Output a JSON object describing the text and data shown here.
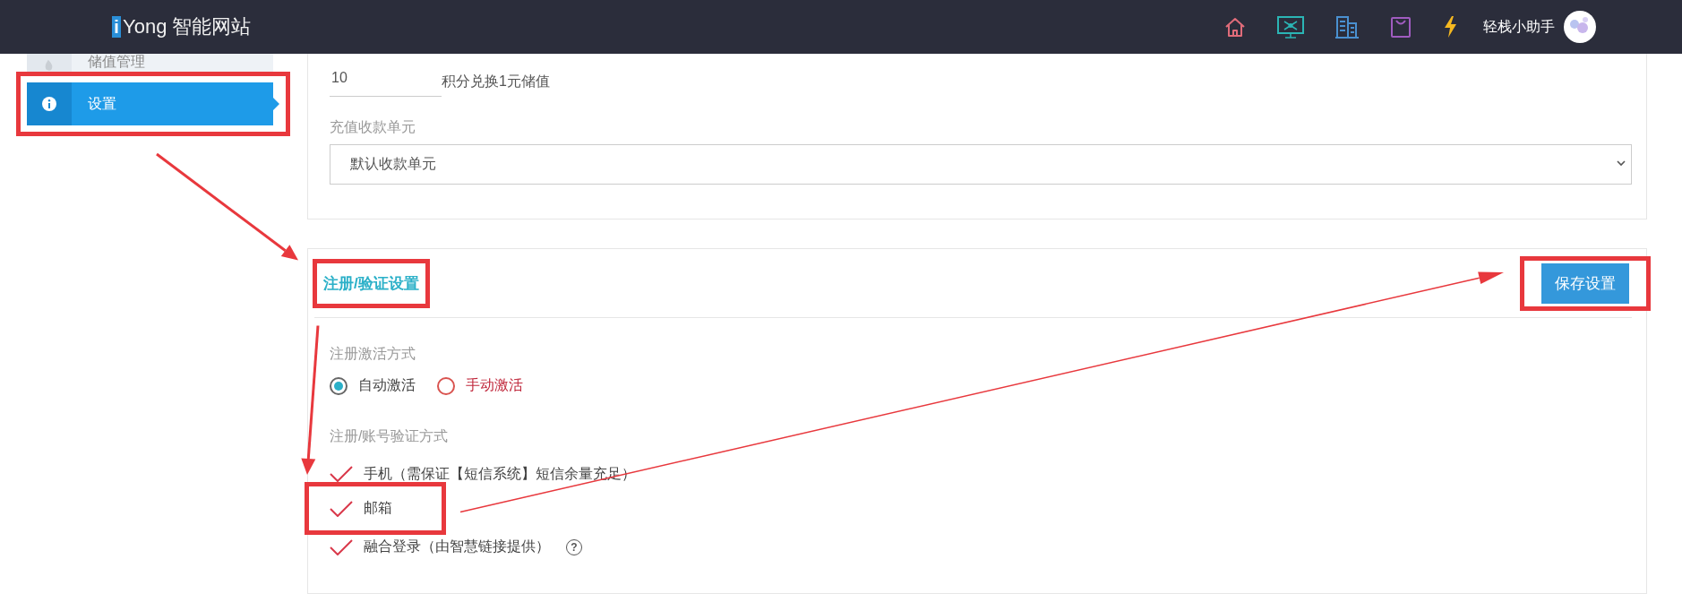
{
  "header": {
    "logo_mark": "i",
    "logo_text": "Yong 智能网站",
    "user_name": "轻栈小助手"
  },
  "sidebar": {
    "items": [
      {
        "label": "储值管理",
        "selected": false,
        "highlighted": false
      },
      {
        "label": "设置",
        "selected": true,
        "highlighted": true
      }
    ]
  },
  "points_panel": {
    "rate_input": {
      "value": "10"
    },
    "rate_label": "积分兑换1元储值",
    "unit_label": "充值收款单元",
    "unit_select": {
      "value": "默认收款单元"
    }
  },
  "verify_panel": {
    "title": "注册/验证设置",
    "title_highlighted": true,
    "save_button": {
      "label": "保存设置",
      "highlighted": true
    },
    "activation": {
      "label": "注册激活方式",
      "options": [
        {
          "label": "自动激活",
          "selected": true
        },
        {
          "label": "手动激活",
          "selected": false
        }
      ]
    },
    "methods": {
      "label": "注册/账号验证方式",
      "options": [
        {
          "label": "手机（需保证【短信系统】短信余量充足）",
          "checked": true,
          "highlighted": false
        },
        {
          "label": "邮箱",
          "checked": true,
          "highlighted": true
        },
        {
          "label": "融合登录（由智慧链接提供）",
          "checked": true,
          "highlighted": false,
          "help": "?"
        }
      ]
    }
  },
  "annotations": {
    "arrows": [
      {
        "heavy": true
      },
      {
        "heavy": true
      },
      {
        "heavy": false
      }
    ]
  }
}
